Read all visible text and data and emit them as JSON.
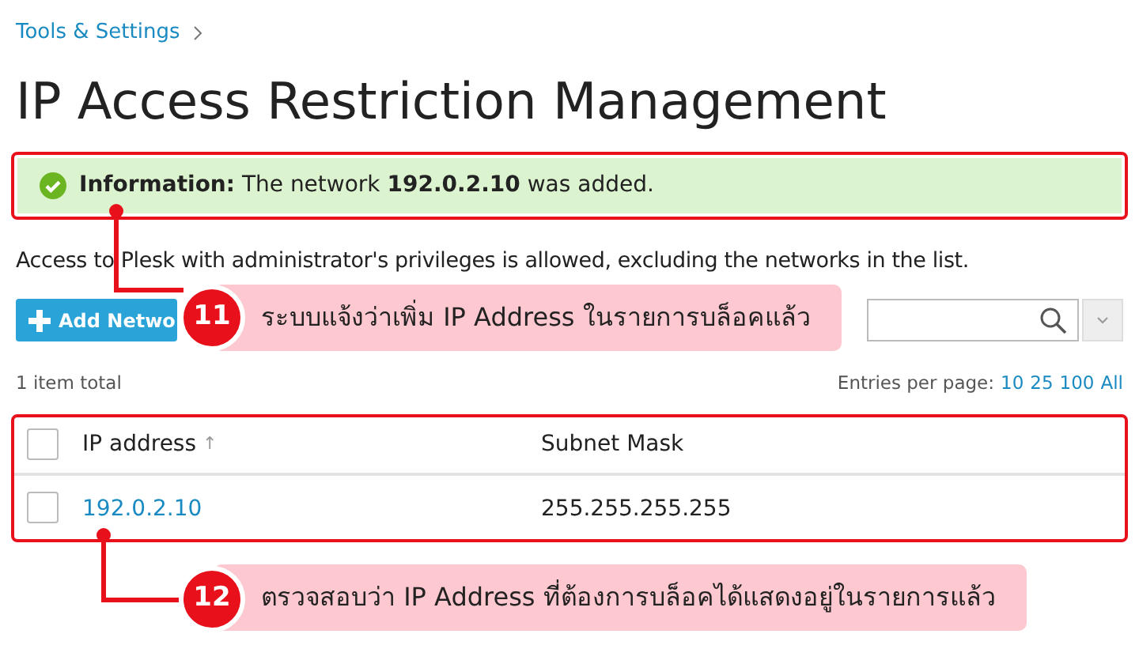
{
  "breadcrumb": [
    {
      "label": "Tools & Settings"
    }
  ],
  "title": "IP Access Restriction Management",
  "notification": {
    "message": "**Information:** The network **192.0.2.10** was added."
  },
  "description": "Access to Plesk with administrator's privileges is allowed, excluding the networks in the list.",
  "toolbar": {
    "add_button": "Add Netwo"
  },
  "list_info": {
    "total": "1 item total",
    "entries_label": "Entries per page:",
    "page_sizes": [
      "10",
      "25",
      "100",
      "All"
    ]
  },
  "table": {
    "header_checked": false,
    "columns": [
      {
        "label": "IP address",
        "sort_mark": "↑"
      },
      {
        "label": "Subnet Mask"
      }
    ],
    "rows": [
      {
        "checked": false,
        "cells": [
          "192.0.2.10",
          "255.255.255.255"
        ]
      }
    ]
  },
  "annotations": [
    {
      "number": "11",
      "text": "ระบบแจ้งว่าเพิ่ม IP Address ในรายการบล็อคแล้ว"
    },
    {
      "number": "12",
      "text": "ตรวจสอบว่า IP Address ที่ต้องการบล็อคได้แสดงอยู่ในรายการแล้ว"
    }
  ]
}
